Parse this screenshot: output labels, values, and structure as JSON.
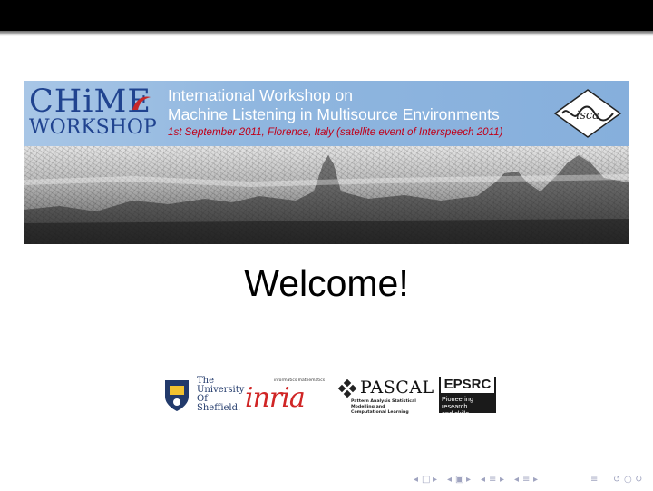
{
  "banner": {
    "logo_title": "CHiME",
    "logo_sub": "WORKSHOP",
    "title_line1": "International Workshop on",
    "title_line2": "Machine Listening in Multisource Environments",
    "date_line": "1st September 2011, Florence, Italy (satellite event of Interspeech 2011)",
    "isca_logo_text": "isca",
    "colors": {
      "banner_blue": "#8fb6df",
      "logo_blue": "#20438f",
      "date_red": "#c0001a"
    }
  },
  "welcome": "Welcome!",
  "sponsors": {
    "sheffield": {
      "line1": "The",
      "line2": "University",
      "line3": "Of",
      "line4": "Sheffield.",
      "icon": "shield-icon"
    },
    "inria": {
      "tagline_left": "informatics",
      "tagline_right": "mathematics",
      "wordmark": "inria"
    },
    "pascal": {
      "name": "PASCAL",
      "desc_line1": "Pattern Analysis Statistical Modelling and",
      "desc_line2": "Computational Learning",
      "icon": "pascal-diamond-icon"
    },
    "epsrc": {
      "name": "EPSRC",
      "tag_line1": "Pioneering research",
      "tag_line2": "and skills"
    }
  },
  "navigation": {
    "icons": [
      "nav-prev-frame-icon",
      "nav-frame-icon",
      "nav-next-frame-icon",
      "nav-prev-subsection-icon",
      "nav-subsection-icon",
      "nav-next-subsection-icon",
      "nav-prev-section-icon",
      "nav-section-icon",
      "nav-next-section-icon",
      "nav-menu-icon",
      "nav-back-icon",
      "nav-search-icon"
    ],
    "color": "#a0a4c0"
  }
}
